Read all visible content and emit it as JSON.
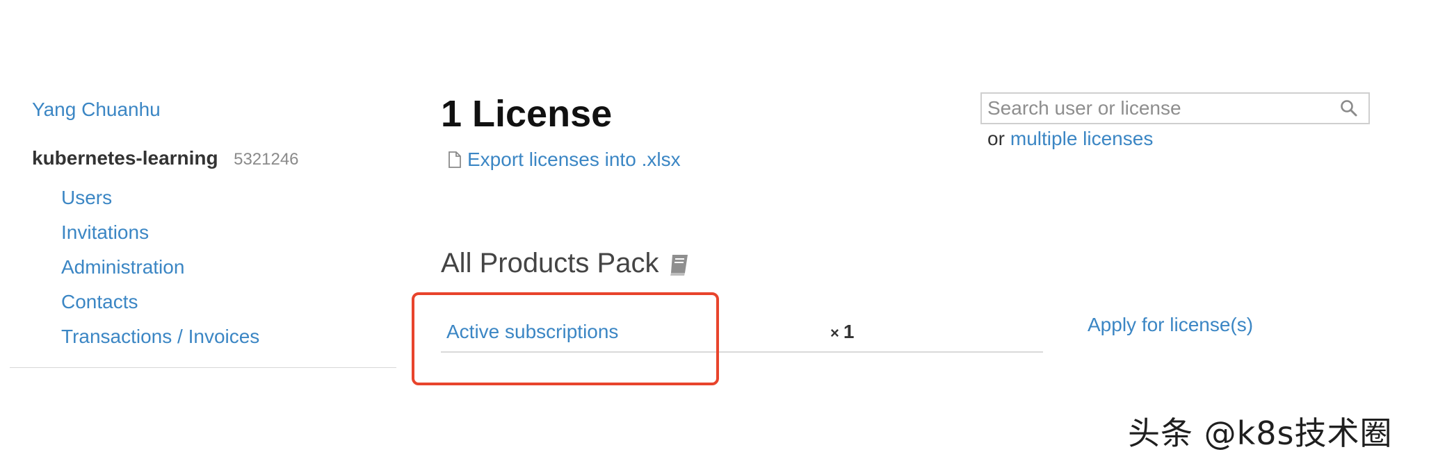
{
  "sidebar": {
    "user_name": "Yang Chuanhu",
    "org_name": "kubernetes-learning",
    "org_id": "5321246",
    "nav_items": [
      {
        "label": "Users"
      },
      {
        "label": "Invitations"
      },
      {
        "label": "Administration"
      },
      {
        "label": "Contacts"
      },
      {
        "label": "Transactions / Invoices"
      }
    ]
  },
  "main": {
    "title": "1 License",
    "export_label": "Export licenses into .xlsx",
    "product_title": "All Products Pack",
    "subscription_link": "Active subscriptions",
    "subscription_count_prefix": "×",
    "subscription_count": "1",
    "apply_link": "Apply for license(s)"
  },
  "search": {
    "placeholder": "Search user or license",
    "value": "",
    "or_text": "or",
    "multiple_link": "multiple licenses"
  },
  "watermark": {
    "text": "头条 @k8s技术圈"
  },
  "colors": {
    "link": "#3b86c4",
    "highlight": "#e8442c",
    "divider": "#d9d9d9"
  },
  "icons": {
    "export": "document-icon",
    "product": "book-icon",
    "search": "magnifier-icon"
  }
}
